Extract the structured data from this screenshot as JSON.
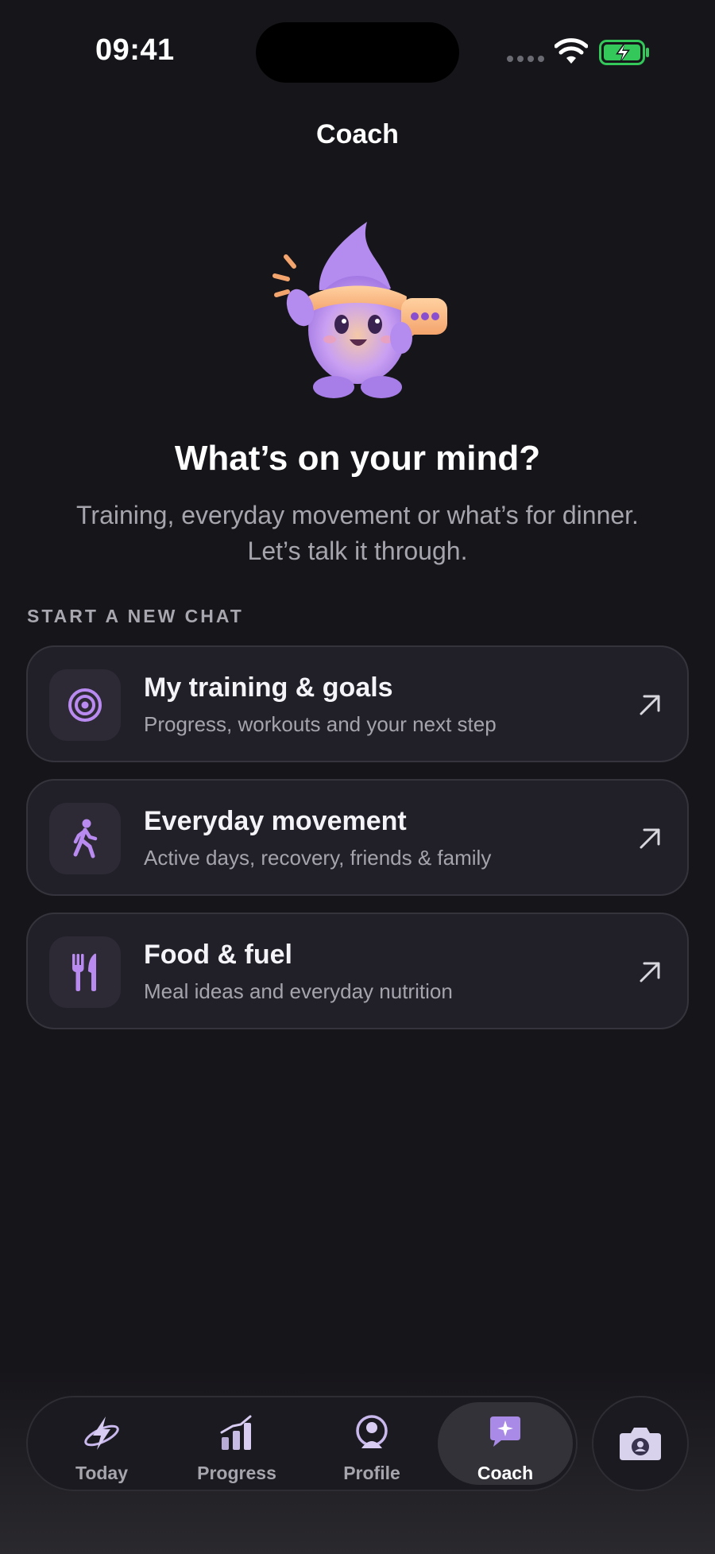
{
  "status_bar": {
    "time": "09:41"
  },
  "header": {
    "title": "Coach"
  },
  "intro": {
    "headline": "What’s on your mind?",
    "subtitle_line1": "Training, everyday movement or what’s for dinner.",
    "subtitle_line2": "Let’s talk it through."
  },
  "section": {
    "label": "START A NEW CHAT"
  },
  "chat_options": [
    {
      "title": "My training & goals",
      "subtitle": "Progress, workouts and your next step",
      "icon": "target-icon"
    },
    {
      "title": "Everyday movement",
      "subtitle": "Active days, recovery, friends & family",
      "icon": "walking-icon"
    },
    {
      "title": "Food & fuel",
      "subtitle": "Meal ideas and everyday nutrition",
      "icon": "fork-knife-icon"
    }
  ],
  "tabs": [
    {
      "label": "Today",
      "icon": "lightning-icon"
    },
    {
      "label": "Progress",
      "icon": "bar-chart-icon"
    },
    {
      "label": "Profile",
      "icon": "profile-icon"
    },
    {
      "label": "Coach",
      "icon": "chat-sparkle-icon",
      "active": true
    }
  ],
  "colors": {
    "accent": "#b98bf0",
    "background": "#16151a",
    "card": "#211f28",
    "battery": "#34c759"
  }
}
